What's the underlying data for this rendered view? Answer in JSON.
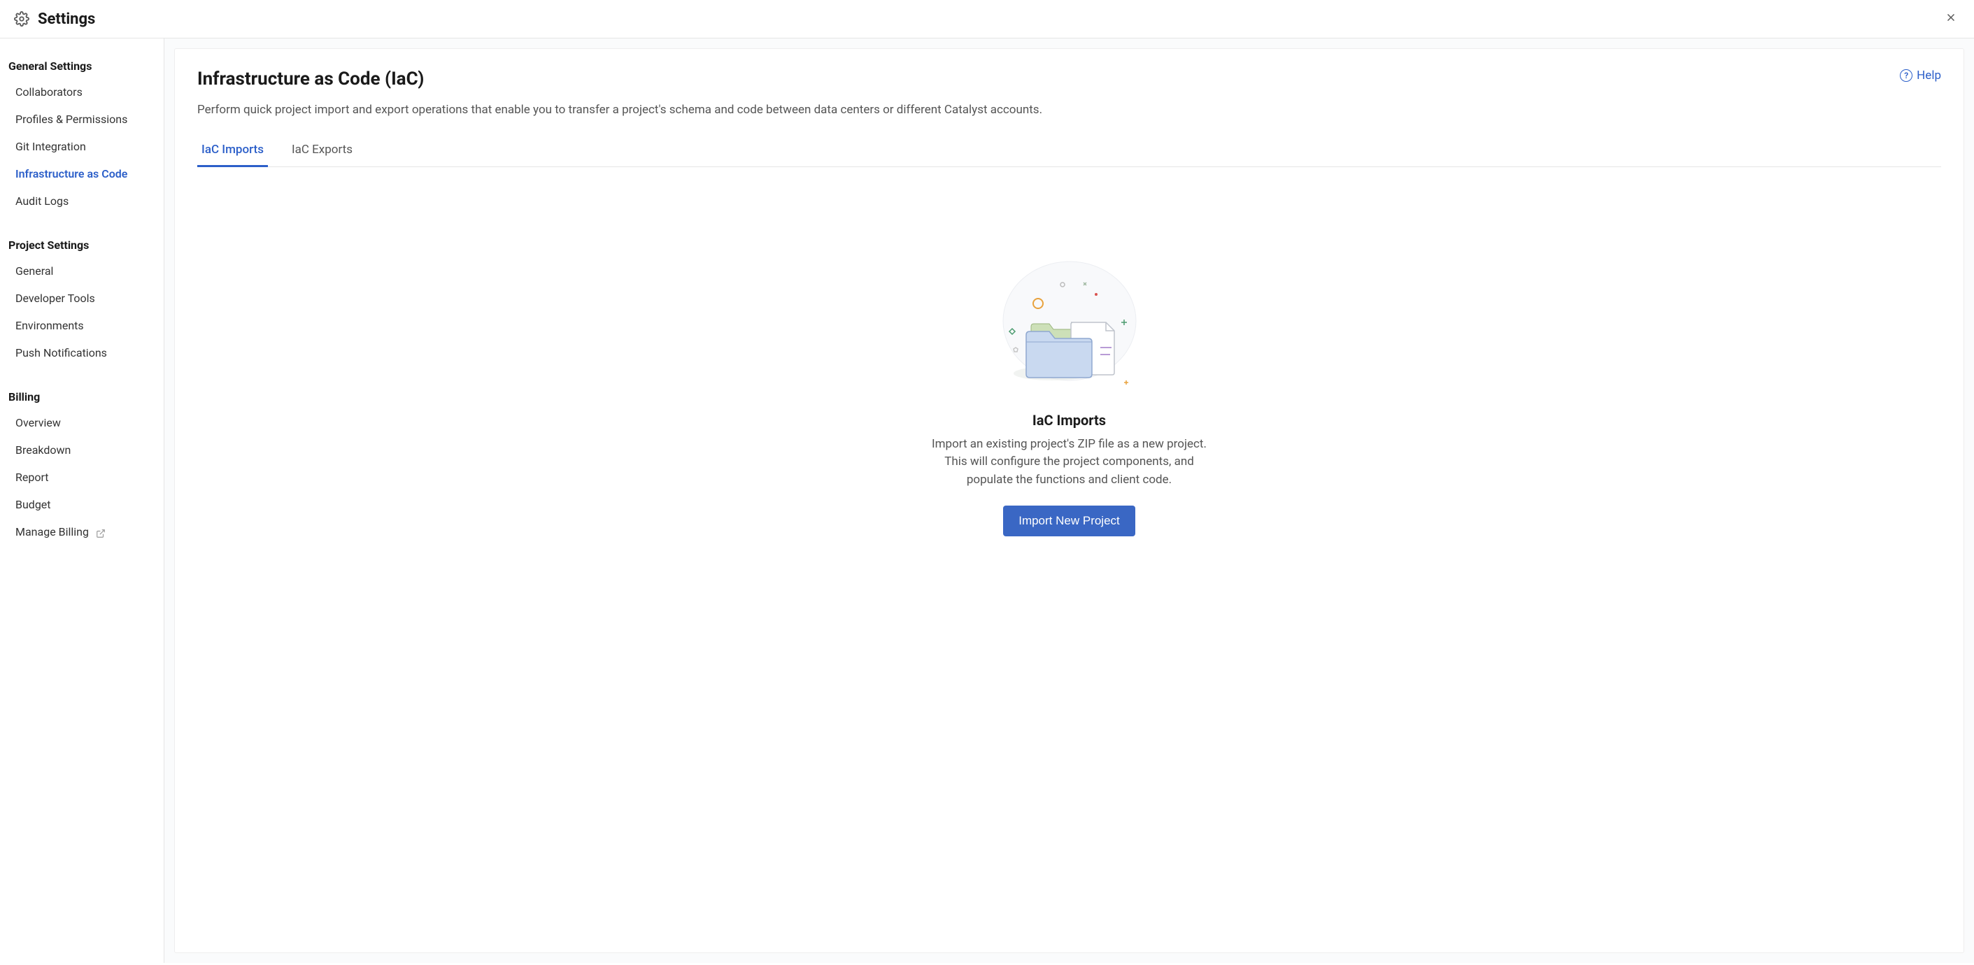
{
  "header": {
    "title": "Settings"
  },
  "sidebar": {
    "section1_title": "General Settings",
    "section1": {
      "i0": "Collaborators",
      "i1": "Profiles & Permissions",
      "i2": "Git Integration",
      "i3": "Infrastructure as Code",
      "i4": "Audit Logs"
    },
    "section2_title": "Project Settings",
    "section2": {
      "i0": "General",
      "i1": "Developer Tools",
      "i2": "Environments",
      "i3": "Push Notifications"
    },
    "section3_title": "Billing",
    "section3": {
      "i0": "Overview",
      "i1": "Breakdown",
      "i2": "Report",
      "i3": "Budget",
      "i4": "Manage Billing"
    }
  },
  "main": {
    "title": "Infrastructure as Code (IaC)",
    "description": "Perform quick project import and export operations that enable you to transfer a project's schema and code between data centers or different Catalyst accounts.",
    "help_label": "Help",
    "tabs": {
      "t0": "IaC Imports",
      "t1": "IaC Exports"
    },
    "empty": {
      "title": "IaC Imports",
      "description": "Import an existing project's ZIP file as a new project. This will configure the project components, and populate the functions and client code.",
      "button": "Import New Project"
    }
  }
}
